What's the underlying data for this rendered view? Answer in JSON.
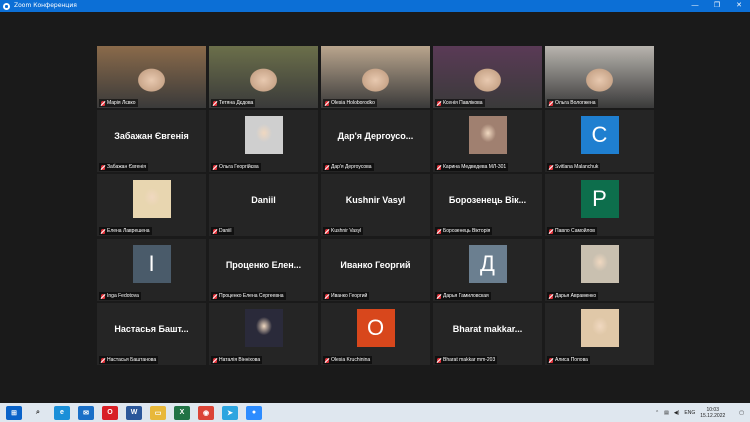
{
  "window": {
    "title": "Zoom Конференция",
    "controls": {
      "minimize": "—",
      "maximize": "❐",
      "close": "✕"
    }
  },
  "participants": [
    {
      "name": "Марія Лєвко",
      "display": "photo",
      "color": "#8a6a4a"
    },
    {
      "name": "Тетяна Дєдова",
      "display": "photo",
      "color": "#6b6f4a",
      "active": true
    },
    {
      "name": "Olesia Holoborodko",
      "display": "photo",
      "color": "#b9a58d"
    },
    {
      "name": "Ксенія Павлікова",
      "display": "photo",
      "color": "#5a3a56"
    },
    {
      "name": "Ольга Вологжена",
      "display": "photo",
      "color": "#b8b4ae"
    },
    {
      "name": "Забажан Євгенія",
      "display": "name",
      "center": "Забажан Євгенія"
    },
    {
      "name": "Ольга Георгійєва",
      "display": "avatar",
      "color": "#cfcfcf"
    },
    {
      "name": "Дар'я Дергоусова",
      "display": "name",
      "center": "Дар'я Дергоусо..."
    },
    {
      "name": "Карина Медведева МЛ-301",
      "display": "avatar",
      "color": "#a08070"
    },
    {
      "name": "Svitlana Malanchuk",
      "display": "letter",
      "letter": "С",
      "color": "#1f7fd0"
    },
    {
      "name": "Елена Лаврешена",
      "display": "avatar",
      "color": "#e8d6b0"
    },
    {
      "name": "Daniil",
      "display": "name",
      "center": "Daniil"
    },
    {
      "name": "Kushnir Vasyl",
      "display": "name",
      "center": "Kushnir Vasyl"
    },
    {
      "name": "Борозенець Вікторія",
      "display": "name",
      "center": "Борозенець Вік..."
    },
    {
      "name": "Павло Самойлов",
      "display": "letter",
      "letter": "P",
      "color": "#0d6e4c"
    },
    {
      "name": "Inga Fedotova",
      "display": "letter",
      "letter": "I",
      "color": "#4a5b6a"
    },
    {
      "name": "Проценко Елена Сергеевна",
      "display": "name",
      "center": "Проценко Елен..."
    },
    {
      "name": "Иванко Георгий",
      "display": "name",
      "center": "Иванко Георгий"
    },
    {
      "name": "Дарья Гамиловская",
      "display": "letter",
      "letter": "Д",
      "color": "#6b7f90"
    },
    {
      "name": "Дарья Авраменко",
      "display": "avatar",
      "color": "#c9c0b0"
    },
    {
      "name": "Настасья Баштанова",
      "display": "name",
      "center": "Настасья Башт..."
    },
    {
      "name": "Наталія Вінніхова",
      "display": "avatar",
      "color": "#2a2a3a"
    },
    {
      "name": "Olesia Kruchinina",
      "display": "letter",
      "letter": "O",
      "color": "#d8471c"
    },
    {
      "name": "Bharat makkar mm-203",
      "display": "name",
      "center": "Bharat makkar..."
    },
    {
      "name": "Алиса Попова",
      "display": "avatar",
      "color": "#e0c8a8"
    }
  ],
  "taskbar": {
    "apps": [
      {
        "name": "windows-start",
        "glyph": "⊞",
        "color": "#0a63c9"
      },
      {
        "name": "search",
        "glyph": "⌕",
        "color": "#333333"
      },
      {
        "name": "edge",
        "glyph": "e",
        "color": "#1a8fd8"
      },
      {
        "name": "mail",
        "glyph": "✉",
        "color": "#1a6fc7"
      },
      {
        "name": "opera",
        "glyph": "O",
        "color": "#d81f26"
      },
      {
        "name": "word",
        "glyph": "W",
        "color": "#2b579a"
      },
      {
        "name": "explorer",
        "glyph": "▭",
        "color": "#e8b83a"
      },
      {
        "name": "excel",
        "glyph": "X",
        "color": "#217346"
      },
      {
        "name": "chrome",
        "glyph": "◉",
        "color": "#db4437"
      },
      {
        "name": "telegram",
        "glyph": "➤",
        "color": "#2ca5e0"
      },
      {
        "name": "zoom",
        "glyph": "●",
        "color": "#2d8cff"
      }
    ],
    "tray": {
      "lang": "ENG",
      "time": "10:03",
      "date": "15.12.2022"
    }
  }
}
